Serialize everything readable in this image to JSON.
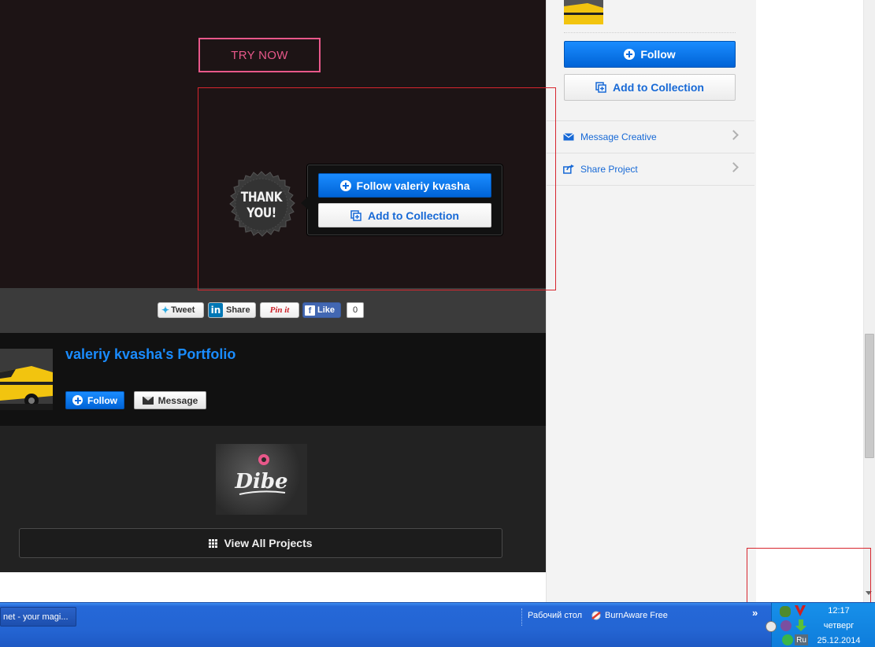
{
  "hero": {
    "try_now_label": "TRY NOW",
    "thanks_text": "THANK\nYOU!",
    "popup_follow_label": "Follow valeriy kvasha",
    "popup_collection_label": "Add to Collection"
  },
  "share": {
    "tweet_label": "Tweet",
    "linkedin_in": "in",
    "linkedin_label": "Share",
    "pinit_label": "Pin it",
    "facebook_f": "f",
    "like_label": "Like",
    "like_count": "0"
  },
  "portfolio": {
    "title": "valeriy kvasha's Portfolio",
    "follow_label": "Follow",
    "message_label": "Message",
    "thumb_logo": "Dibe",
    "view_all_label": "View All Projects"
  },
  "sidebar": {
    "follow_label": "Follow",
    "collection_label": "Add to Collection",
    "message_creative_label": "Message Creative",
    "share_project_label": "Share Project"
  },
  "taskbar": {
    "task_label": "net - your magi...",
    "desktop_label": "Рабочий стол",
    "burnaware_label": "BurnAware Free",
    "more_label": "»",
    "lang_label": "Ru",
    "time": "12:17",
    "weekday": "четверг",
    "date": "25.12.2014"
  },
  "colors": {
    "accent_blue": "#1a8cff",
    "try_now_pink": "#e8588a",
    "annotation_red": "#d7262e"
  }
}
